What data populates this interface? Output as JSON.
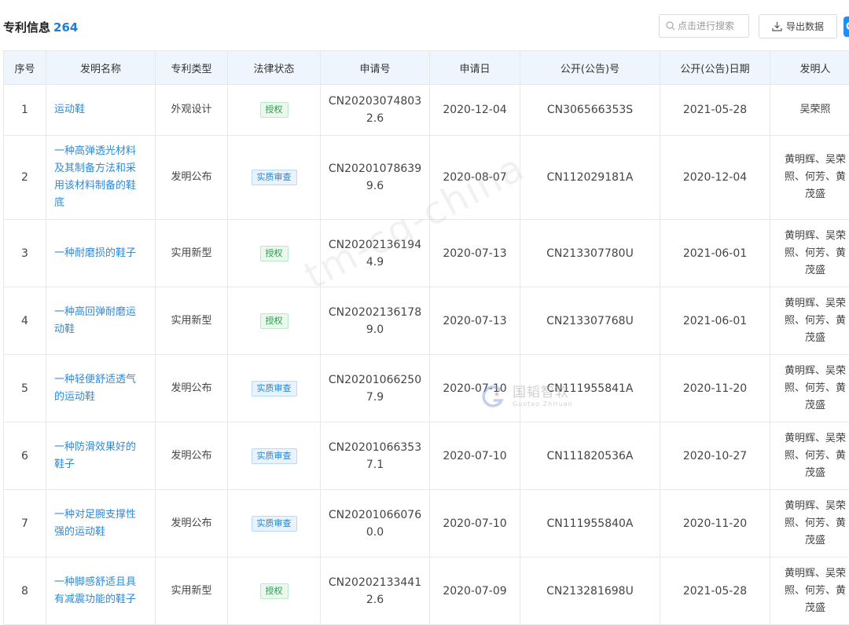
{
  "header": {
    "title": "专利信息",
    "count": "264",
    "search_placeholder": "点击进行搜索",
    "export_label": "导出数据",
    "edge_label": "G"
  },
  "table": {
    "columns": [
      "序号",
      "发明名称",
      "专利类型",
      "法律状态",
      "申请号",
      "申请日",
      "公开(公告)号",
      "公开(公告)日期",
      "发明人"
    ],
    "rows": [
      {
        "index": "1",
        "name_lines": [
          "运动鞋"
        ],
        "type": "外观设计",
        "status": "授权",
        "app_lines": [
          "CN20203074803",
          "2.6"
        ],
        "app_date": "2020-12-04",
        "pub_no": "CN306566353S",
        "pub_date": "2021-05-28",
        "inventor_lines": [
          "吴荣照"
        ]
      },
      {
        "index": "2",
        "name_lines": [
          "一种高弹透光材料",
          "及其制备方法和采",
          "用该材料制备的鞋",
          "底"
        ],
        "type": "发明公布",
        "status": "实质审查",
        "app_lines": [
          "CN20201078639",
          "9.6"
        ],
        "app_date": "2020-08-07",
        "pub_no": "CN112029181A",
        "pub_date": "2020-12-04",
        "inventor_lines": [
          "黄明辉、吴荣",
          "照、何芳、黄",
          "茂盛"
        ]
      },
      {
        "index": "3",
        "name_lines": [
          "一种耐磨损的鞋子"
        ],
        "type": "实用新型",
        "status": "授权",
        "app_lines": [
          "CN20202136194",
          "4.9"
        ],
        "app_date": "2020-07-13",
        "pub_no": "CN213307780U",
        "pub_date": "2021-06-01",
        "inventor_lines": [
          "黄明辉、吴荣",
          "照、何芳、黄",
          "茂盛"
        ]
      },
      {
        "index": "4",
        "name_lines": [
          "一种高回弹耐磨运",
          "动鞋"
        ],
        "type": "实用新型",
        "status": "授权",
        "app_lines": [
          "CN20202136178",
          "9.0"
        ],
        "app_date": "2020-07-13",
        "pub_no": "CN213307768U",
        "pub_date": "2021-06-01",
        "inventor_lines": [
          "黄明辉、吴荣",
          "照、何芳、黄",
          "茂盛"
        ]
      },
      {
        "index": "5",
        "name_lines": [
          "一种轻便舒适透气",
          "的运动鞋"
        ],
        "type": "发明公布",
        "status": "实质审查",
        "app_lines": [
          "CN20201066250",
          "7.9"
        ],
        "app_date": "2020-07-10",
        "pub_no": "CN111955841A",
        "pub_date": "2020-11-20",
        "inventor_lines": [
          "黄明辉、吴荣",
          "照、何芳、黄",
          "茂盛"
        ]
      },
      {
        "index": "6",
        "name_lines": [
          "一种防滑效果好的",
          "鞋子"
        ],
        "type": "发明公布",
        "status": "实质审查",
        "app_lines": [
          "CN20201066353",
          "7.1"
        ],
        "app_date": "2020-07-10",
        "pub_no": "CN111820536A",
        "pub_date": "2020-10-27",
        "inventor_lines": [
          "黄明辉、吴荣",
          "照、何芳、黄",
          "茂盛"
        ]
      },
      {
        "index": "7",
        "name_lines": [
          "一种对足腕支撑性",
          "强的运动鞋"
        ],
        "type": "发明公布",
        "status": "实质审查",
        "app_lines": [
          "CN20201066076",
          "0.0"
        ],
        "app_date": "2020-07-10",
        "pub_no": "CN111955840A",
        "pub_date": "2020-11-20",
        "inventor_lines": [
          "黄明辉、吴荣",
          "照、何芳、黄",
          "茂盛"
        ]
      },
      {
        "index": "8",
        "name_lines": [
          "一种脚感舒适且具",
          "有减震功能的鞋子"
        ],
        "type": "实用新型",
        "status": "授权",
        "app_lines": [
          "CN20202133441",
          "2.6"
        ],
        "app_date": "2020-07-09",
        "pub_no": "CN213281698U",
        "pub_date": "2021-05-28",
        "inventor_lines": [
          "黄明辉、吴荣",
          "照、何芳、黄",
          "茂盛"
        ]
      }
    ]
  },
  "watermarks": {
    "diagonal": "tm-cg-china",
    "brand_cn": "国韬智软",
    "brand_en": "Guotao Zhiruan"
  },
  "colors": {
    "link": "#2e8ad8",
    "count": "#1f7fd6",
    "header_bg": "#eef5fd",
    "status_granted": "#1fa346",
    "status_exam": "#2a84d4"
  },
  "icons": {
    "search": "search-icon",
    "export": "download-icon"
  }
}
